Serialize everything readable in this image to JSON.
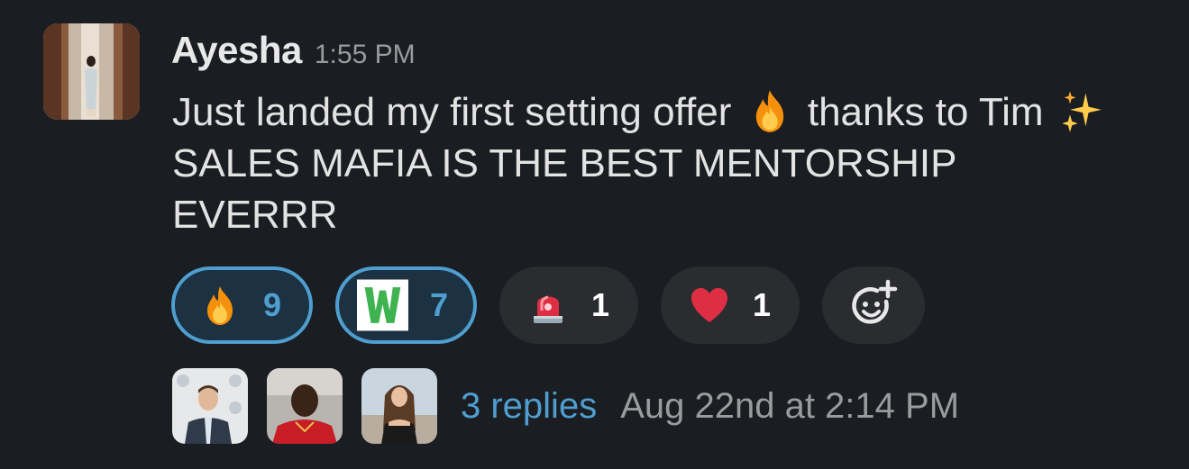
{
  "message": {
    "author": "Ayesha",
    "time": "1:55 PM",
    "text": {
      "part1": "Just landed my first setting offer",
      "part2": "thanks to Tim",
      "part3": "SALES MAFIA IS THE BEST MENTORSHIP EVERRR"
    }
  },
  "reactions": [
    {
      "emoji": "fire",
      "count": "9",
      "reacted_by_me": true
    },
    {
      "emoji": "w-letter",
      "count": "7",
      "reacted_by_me": true
    },
    {
      "emoji": "rotating-light",
      "count": "1",
      "reacted_by_me": false
    },
    {
      "emoji": "red-heart",
      "count": "1",
      "reacted_by_me": false
    }
  ],
  "add_reaction_icon": "add-reaction-smiley-icon",
  "thread": {
    "replies_label": "3 replies",
    "last_reply": "Aug 22nd at 2:14 PM"
  },
  "colors": {
    "background": "#1a1d21",
    "link": "#4f9ed0",
    "reaction_bg": "#2a2c30",
    "reacted_bg": "#1c3141"
  }
}
